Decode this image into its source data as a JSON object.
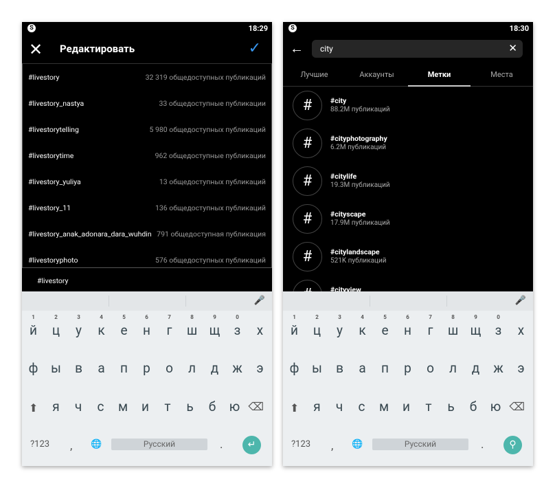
{
  "left": {
    "time": "18:29",
    "title": "Редактировать",
    "close_icon": "close-icon",
    "confirm_icon": "check-icon",
    "tags": [
      {
        "name": "#livestory",
        "count": "32 319 общедоступных публикаций"
      },
      {
        "name": "#livestory_nastya",
        "count": "33 общедоступные публикации"
      },
      {
        "name": "#livestorytelling",
        "count": "5 980 общедоступных публикаций"
      },
      {
        "name": "#livestorytime",
        "count": "962 общедоступные публикации"
      },
      {
        "name": "#livestory_yuliya",
        "count": "13 общедоступных публикаций"
      },
      {
        "name": "#livestory_11",
        "count": "136 общедоступных публикаций"
      },
      {
        "name": "#livestory_anak_adonara_dara_wuhdin",
        "count": "791 общедоступная публикация"
      },
      {
        "name": "#livestoryphoto",
        "count": "576 общедоступных публикаций"
      }
    ],
    "input_value": "#livestory",
    "action_key": "enter-icon"
  },
  "right": {
    "time": "18:30",
    "search_value": "city",
    "tabs": [
      "Лучшие",
      "Аккаунты",
      "Метки",
      "Места"
    ],
    "active_tab": "Метки",
    "results": [
      {
        "name": "#city",
        "count": "88.2M публикаций"
      },
      {
        "name": "#cityphotography",
        "count": "6.2M публикаций"
      },
      {
        "name": "#citylife",
        "count": "19.3M публикаций"
      },
      {
        "name": "#cityscape",
        "count": "17.9M публикаций"
      },
      {
        "name": "#citylandscape",
        "count": "521K публикаций"
      },
      {
        "name": "#cityview",
        "count": ""
      }
    ],
    "action_key": "search-icon"
  },
  "keyboard": {
    "row1": [
      "й",
      "ц",
      "у",
      "к",
      "е",
      "н",
      "г",
      "ш",
      "щ",
      "з",
      "х"
    ],
    "digits": [
      "1",
      "2",
      "3",
      "4",
      "5",
      "6",
      "7",
      "8",
      "9",
      "0"
    ],
    "row2": [
      "ф",
      "ы",
      "в",
      "а",
      "п",
      "р",
      "о",
      "л",
      "д",
      "ж",
      "э"
    ],
    "row3": [
      "я",
      "ч",
      "с",
      "м",
      "и",
      "т",
      "ь",
      "б",
      "ю"
    ],
    "symbols": "?123",
    "comma": ",",
    "period": ".",
    "space": "Русский"
  },
  "accent": "#3897f0",
  "kb_action_color": "#4db6ac"
}
